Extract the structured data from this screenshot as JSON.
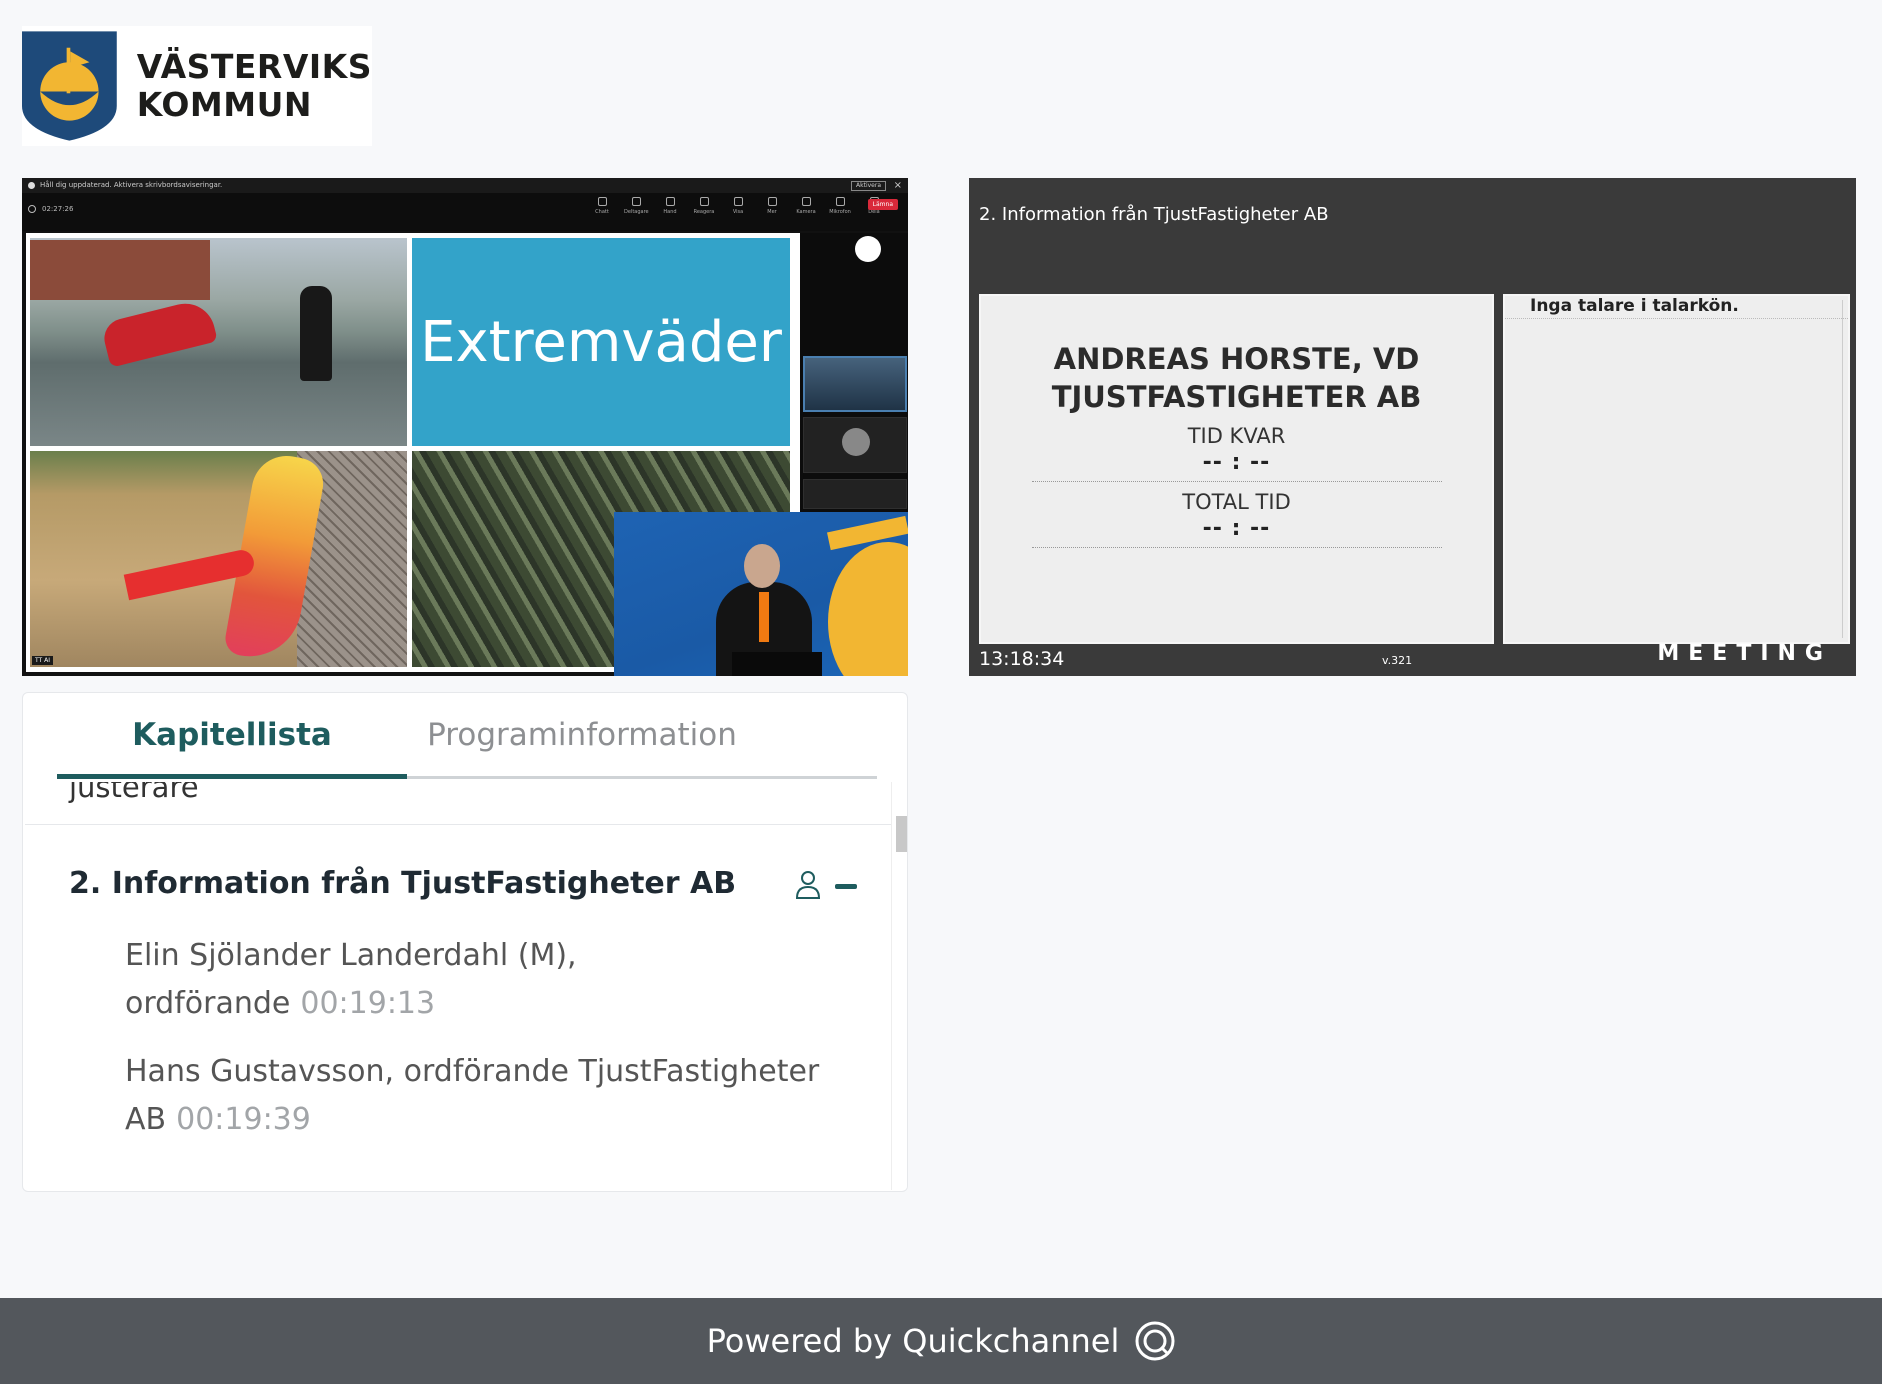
{
  "header": {
    "logo_line1": "VÄSTERVIKS",
    "logo_line2": "KOMMUN"
  },
  "video": {
    "notice": "Håll dig uppdaterad. Aktivera skrivbordsaviseringar.",
    "notice_button": "Aktivera",
    "elapsed": "02:27:26",
    "toolbar": [
      "Chatt",
      "Deltagare",
      "Hand",
      "Reagera",
      "Visa",
      "Mer",
      "Kamera",
      "Mikrofon",
      "Dela"
    ],
    "leave_label": "Lämna",
    "slide_title": "Extremväder",
    "slide_caption": "TT AI"
  },
  "meeting": {
    "agenda_title": "2. Information från TjustFastigheter AB",
    "speaker_line1": "ANDREAS HORSTE, VD",
    "speaker_line2": "TJUSTFASTIGHETER AB",
    "time_left_label": "TID KVAR",
    "time_left_value": "-- : --",
    "total_time_label": "TOTAL TID",
    "total_time_value": "-- : --",
    "queue_empty": "Inga talare i talarkön.",
    "clock": "13:18:34",
    "version": "v.321",
    "brand": "MEETING"
  },
  "chapters": {
    "tabs": [
      {
        "label": "Kapitellista",
        "active": true
      },
      {
        "label": "Programinformation",
        "active": false
      }
    ],
    "cut_item": "justerare",
    "item_title": "2. Information från TjustFastigheter AB",
    "entries": [
      {
        "text": "Elin Sjölander Landerdahl (M), ordförande",
        "time": "00:19:13"
      },
      {
        "text": "Hans Gustavsson, ordförande TjustFastigheter AB",
        "time": "00:19:39"
      }
    ]
  },
  "footer": {
    "text": "Powered by Quickchannel"
  },
  "colors": {
    "accent": "#1e5c5e",
    "footer_bg": "#53575c",
    "meeting_bg": "#3a3a3a",
    "slide_blue": "#33a3c9"
  }
}
